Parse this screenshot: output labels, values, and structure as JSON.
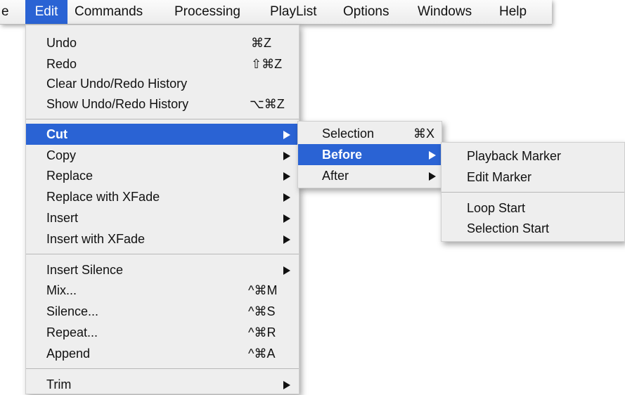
{
  "menubar": {
    "items": [
      {
        "label": "e"
      },
      {
        "label": "Edit"
      },
      {
        "label": "Commands"
      },
      {
        "label": "Processing"
      },
      {
        "label": "PlayList"
      },
      {
        "label": "Options"
      },
      {
        "label": "Windows"
      },
      {
        "label": "Help"
      }
    ]
  },
  "edit_menu": {
    "undo": {
      "label": "Undo",
      "shortcut": "⌘Z"
    },
    "redo": {
      "label": "Redo",
      "shortcut": "⇧⌘Z"
    },
    "clear_history": {
      "label": "Clear Undo/Redo History"
    },
    "show_history": {
      "label": "Show Undo/Redo History",
      "shortcut": "⌥⌘Z"
    },
    "cut": {
      "label": "Cut"
    },
    "copy": {
      "label": "Copy"
    },
    "replace": {
      "label": "Replace"
    },
    "replace_xfade": {
      "label": "Replace with XFade"
    },
    "insert": {
      "label": "Insert"
    },
    "insert_xfade": {
      "label": "Insert with XFade"
    },
    "insert_silence": {
      "label": "Insert Silence"
    },
    "mix": {
      "label": "Mix...",
      "shortcut": "^⌘M"
    },
    "silence": {
      "label": "Silence...",
      "shortcut": "^⌘S"
    },
    "repeat": {
      "label": "Repeat...",
      "shortcut": "^⌘R"
    },
    "append": {
      "label": "Append",
      "shortcut": "^⌘A"
    },
    "trim": {
      "label": "Trim"
    }
  },
  "cut_submenu": {
    "selection": {
      "label": "Selection",
      "shortcut": "⌘X"
    },
    "before": {
      "label": "Before"
    },
    "after": {
      "label": "After"
    }
  },
  "before_submenu": {
    "playback_marker": {
      "label": "Playback Marker"
    },
    "edit_marker": {
      "label": "Edit Marker"
    },
    "loop_start": {
      "label": "Loop Start"
    },
    "selection_start": {
      "label": "Selection Start"
    }
  },
  "colors": {
    "highlight": "#2a63d4",
    "menu_bg": "#eeeeee"
  }
}
